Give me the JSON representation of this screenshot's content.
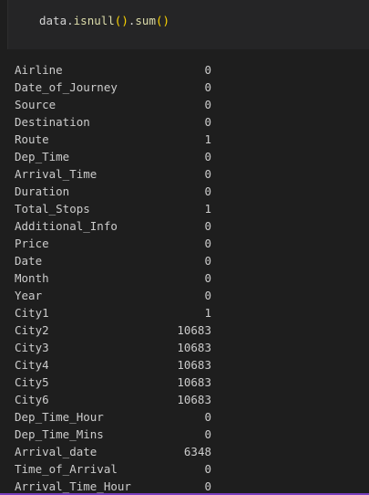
{
  "code_cell": {
    "var": "data",
    "dot1": ".",
    "method1": "isnull",
    "method2": "sum",
    "dot2": ".",
    "paren_open": "(",
    "paren_close": ")"
  },
  "output": {
    "rows": [
      {
        "name": "Airline",
        "count": "0"
      },
      {
        "name": "Date_of_Journey",
        "count": "0"
      },
      {
        "name": "Source",
        "count": "0"
      },
      {
        "name": "Destination",
        "count": "0"
      },
      {
        "name": "Route",
        "count": "1"
      },
      {
        "name": "Dep_Time",
        "count": "0"
      },
      {
        "name": "Arrival_Time",
        "count": "0"
      },
      {
        "name": "Duration",
        "count": "0"
      },
      {
        "name": "Total_Stops",
        "count": "1"
      },
      {
        "name": "Additional_Info",
        "count": "0"
      },
      {
        "name": "Price",
        "count": "0"
      },
      {
        "name": "Date",
        "count": "0"
      },
      {
        "name": "Month",
        "count": "0"
      },
      {
        "name": "Year",
        "count": "0"
      },
      {
        "name": "City1",
        "count": "1"
      },
      {
        "name": "City2",
        "count": "10683"
      },
      {
        "name": "City3",
        "count": "10683"
      },
      {
        "name": "City4",
        "count": "10683"
      },
      {
        "name": "City5",
        "count": "10683"
      },
      {
        "name": "City6",
        "count": "10683"
      },
      {
        "name": "Dep_Time_Hour",
        "count": "0"
      },
      {
        "name": "Dep_Time_Mins",
        "count": "0"
      },
      {
        "name": "Arrival_date",
        "count": "6348"
      },
      {
        "name": "Time_of_Arrival",
        "count": "0"
      },
      {
        "name": "Arrival_Time_Hour",
        "count": "0"
      }
    ]
  },
  "colors": {
    "background": "#1e1e1e",
    "cell_background": "#252526",
    "text": "#cccccc",
    "method": "#dcdcaa",
    "bracket": "#ffd700",
    "accent_bar": "#7b3fbf"
  }
}
